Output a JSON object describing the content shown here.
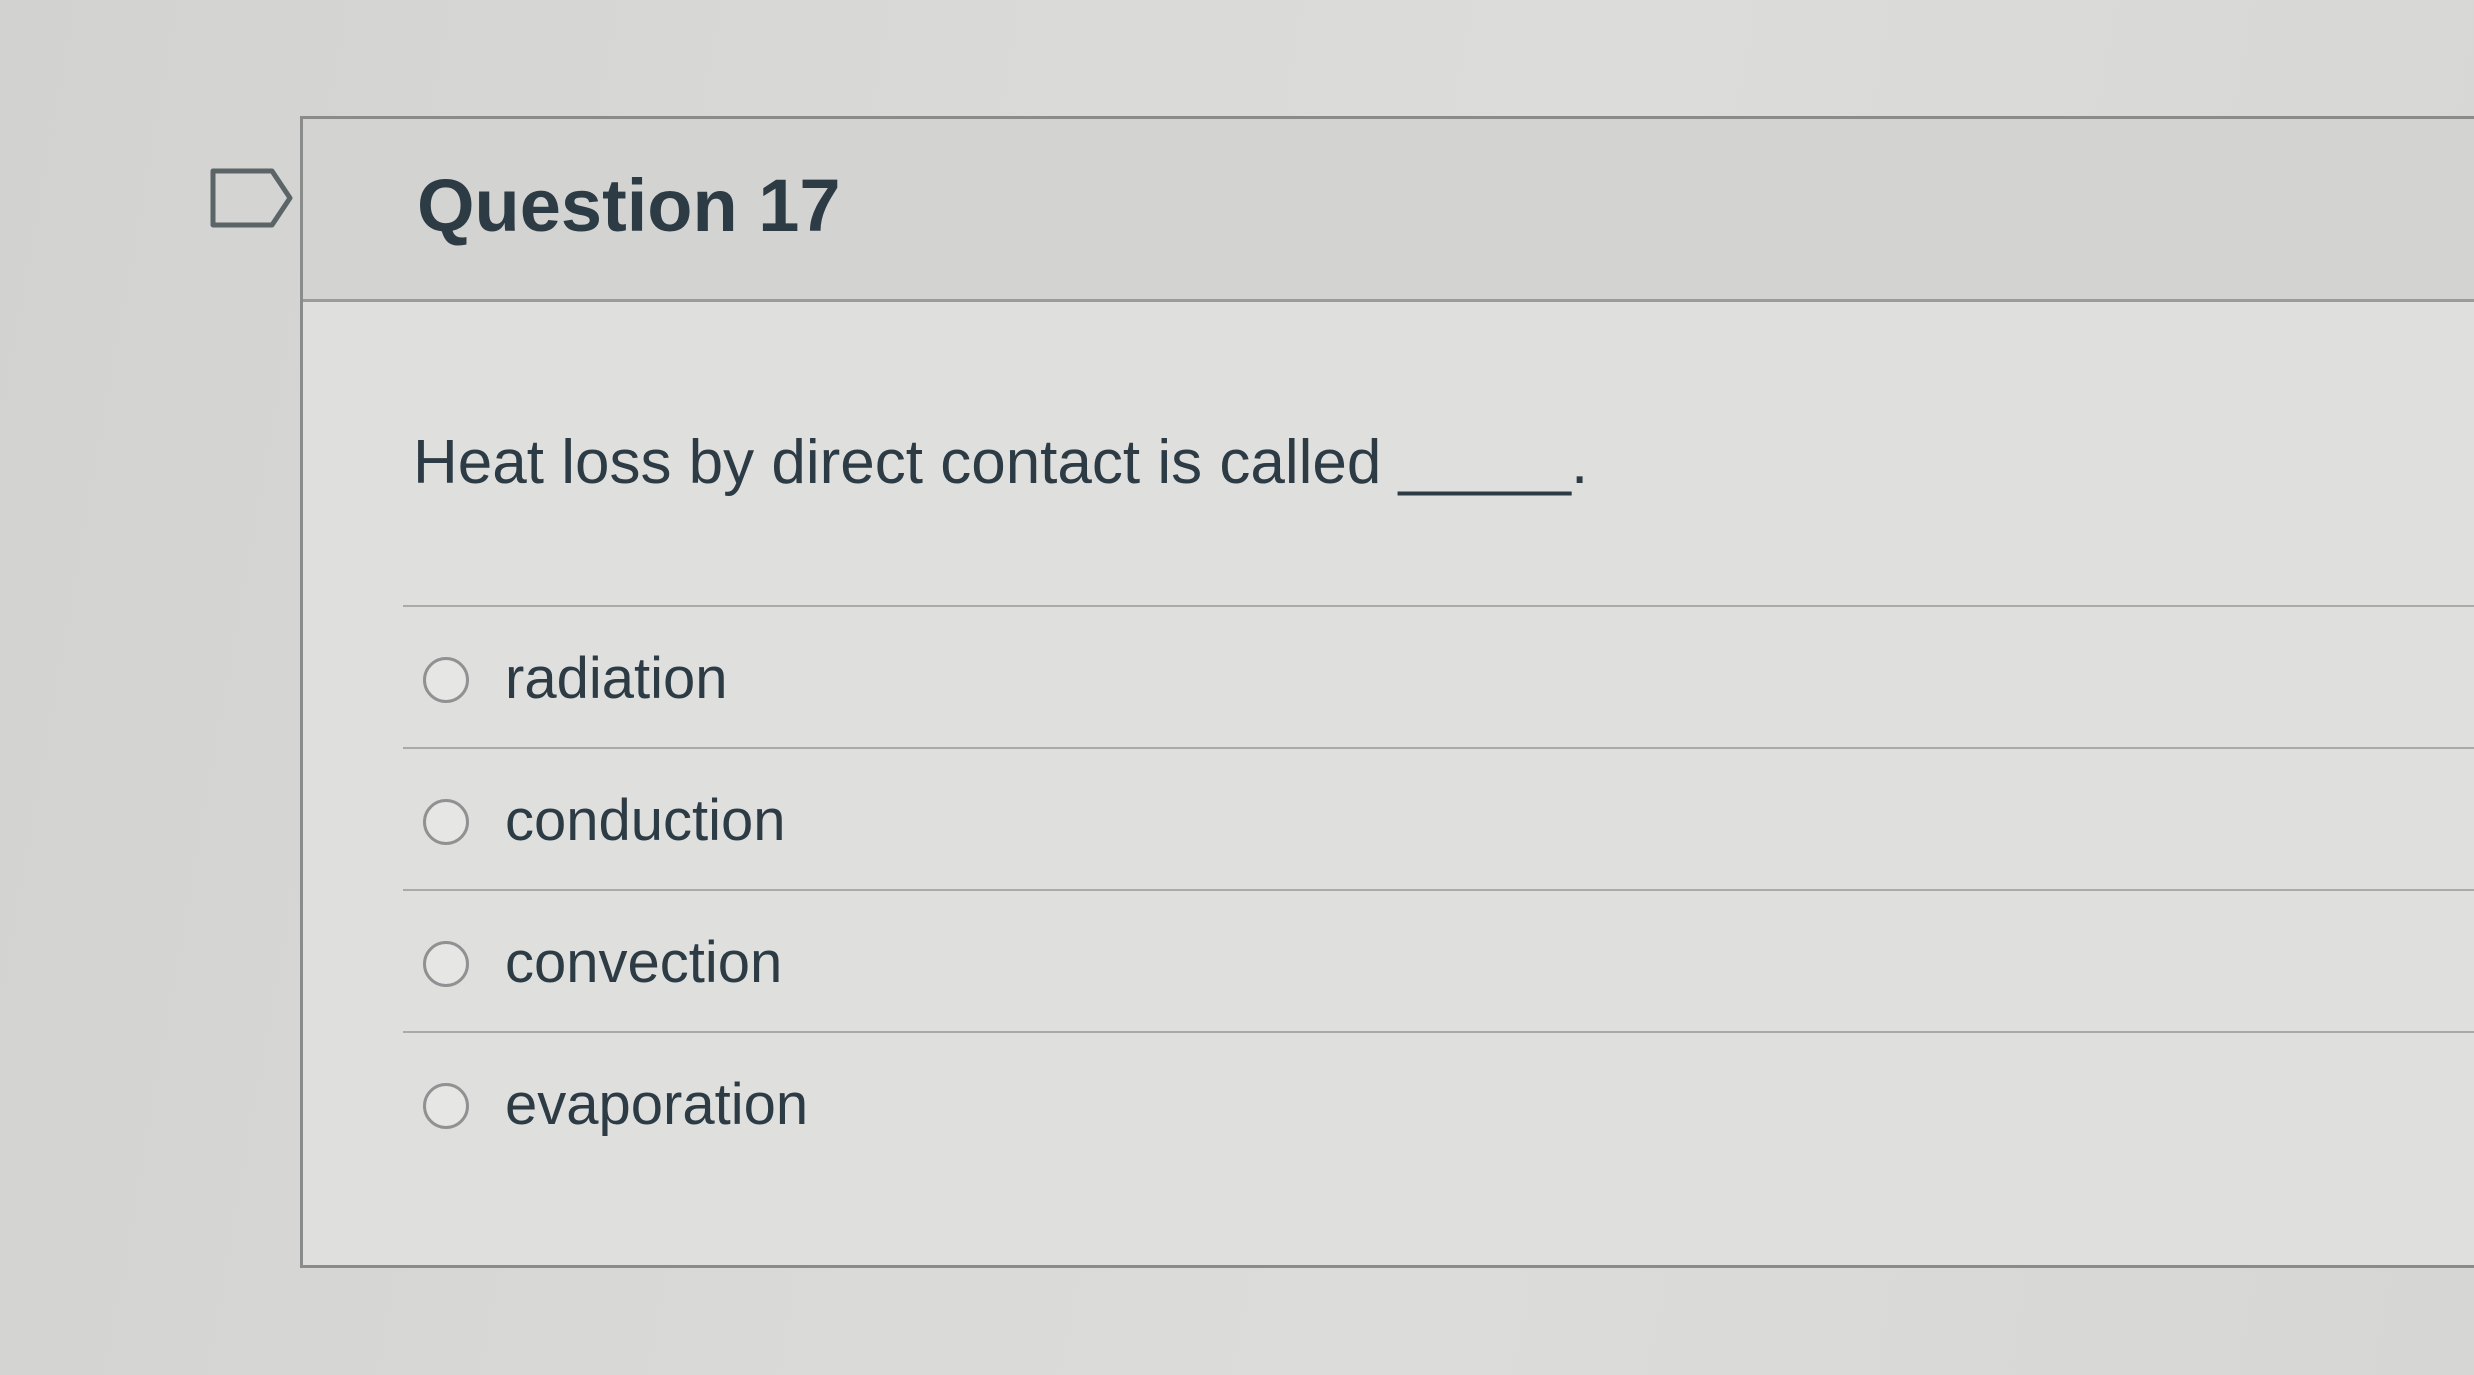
{
  "flag": {
    "icon": "flag-icon"
  },
  "question": {
    "title": "Question 17",
    "text": "Heat loss by direct contact is called _____.",
    "answers": [
      {
        "label": "radiation"
      },
      {
        "label": "conduction"
      },
      {
        "label": "convection"
      },
      {
        "label": "evaporation"
      }
    ]
  }
}
